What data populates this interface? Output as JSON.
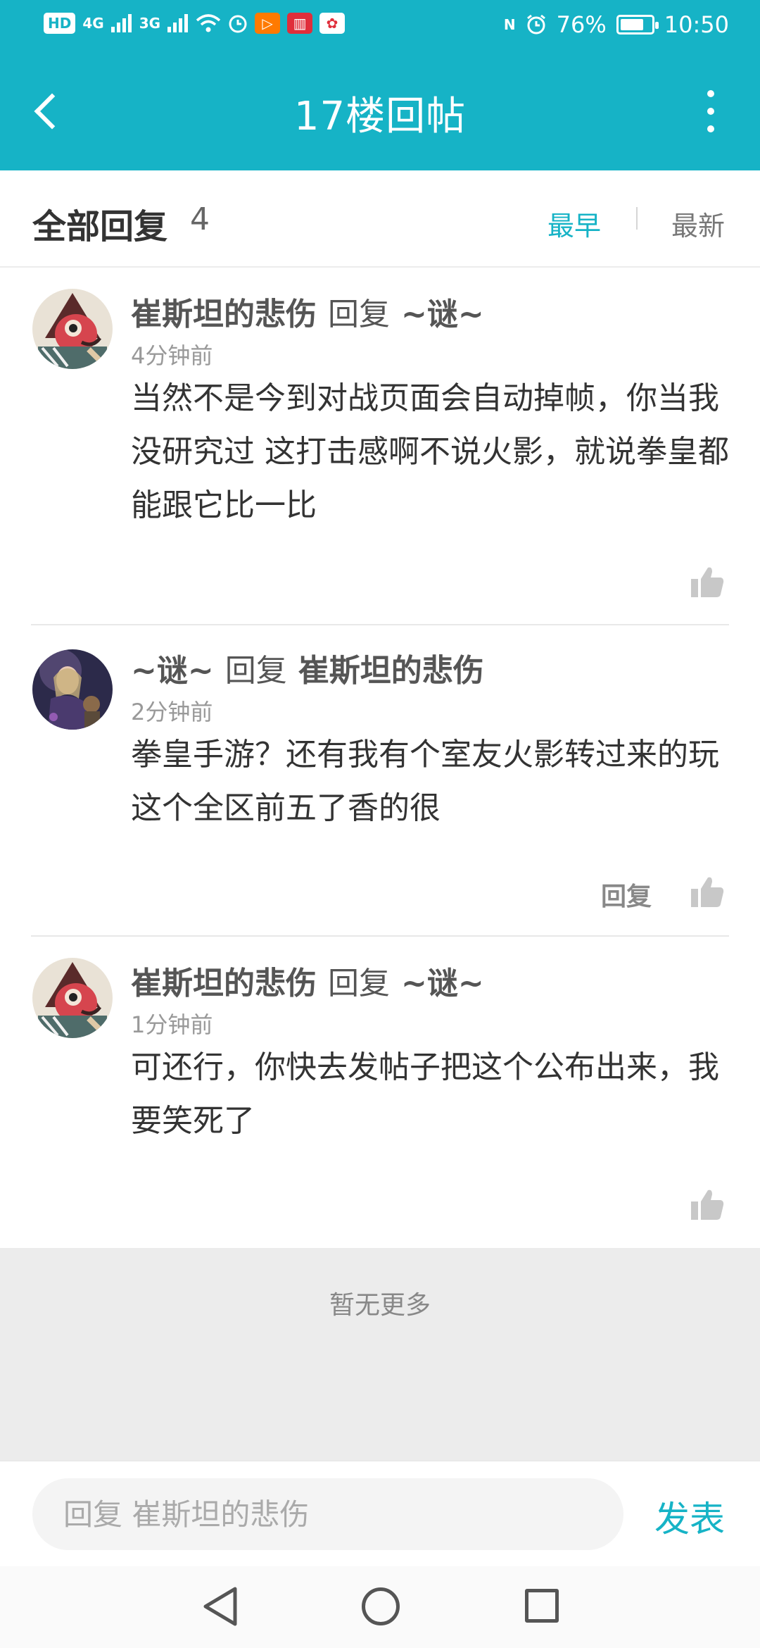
{
  "status_bar": {
    "hd": "HD",
    "net1": "4G",
    "net2": "3G",
    "battery_text": "76%",
    "battery_level": 0.76,
    "time": "10:50",
    "nfc": "N"
  },
  "header": {
    "title": "17楼回帖"
  },
  "replies_bar": {
    "title": "全部回复",
    "count": "4",
    "sort_earliest": "最早",
    "sort_latest": "最新",
    "active_sort": "最早"
  },
  "comments": [
    {
      "author": "崔斯坦的悲伤",
      "verb": "回复",
      "target": "~谜~",
      "time": "4分钟前",
      "body": "当然不是今到对战页面会自动掉帧，你当我没研究过 这打击感啊不说火影，就说拳皇都能跟它比一比"
    },
    {
      "author": "~谜~",
      "verb": "回复",
      "target": "崔斯坦的悲伤",
      "time": "2分钟前",
      "body": "拳皇手游？还有我有个室友火影转过来的玩这个全区前五了香的很",
      "reply_label": "回复"
    },
    {
      "author": "崔斯坦的悲伤",
      "verb": "回复",
      "target": "~谜~",
      "time": "1分钟前",
      "body": "可还行，你快去发帖子把这个公布出来，我要笑死了"
    }
  ],
  "end_area": {
    "text": "暂无更多"
  },
  "compose": {
    "placeholder": "回复 崔斯坦的悲伤",
    "send_label": "发表"
  },
  "colors": {
    "accent": "#16b3c6",
    "end_bg": "#ececec"
  }
}
